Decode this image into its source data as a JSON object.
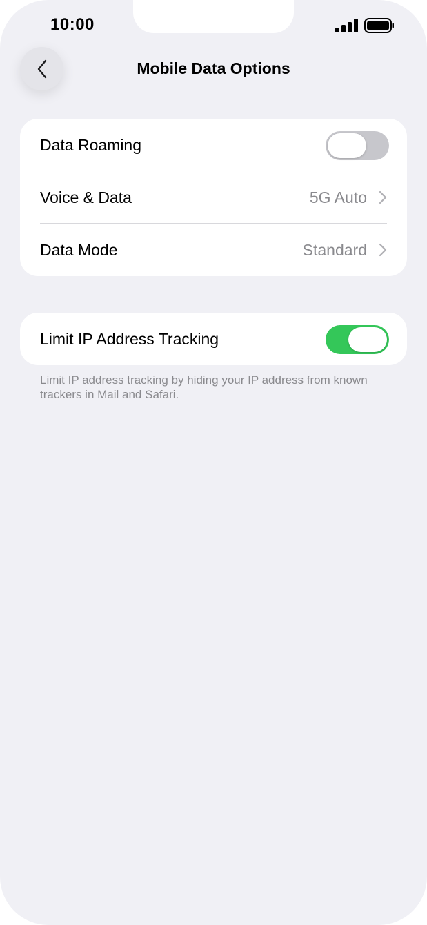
{
  "status_bar": {
    "time": "10:00"
  },
  "nav": {
    "title": "Mobile Data Options"
  },
  "group1": {
    "rows": [
      {
        "label": "Data Roaming",
        "toggle": "off"
      },
      {
        "label": "Voice & Data",
        "value": "5G Auto"
      },
      {
        "label": "Data Mode",
        "value": "Standard"
      }
    ]
  },
  "group2": {
    "rows": [
      {
        "label": "Limit IP Address Tracking",
        "toggle": "on"
      }
    ],
    "footnote": "Limit IP address tracking by hiding your IP address from known trackers in Mail and Safari."
  },
  "colors": {
    "toggle_on": "#34c759",
    "toggle_off": "#c7c7cc",
    "background": "#f0f0f5"
  }
}
